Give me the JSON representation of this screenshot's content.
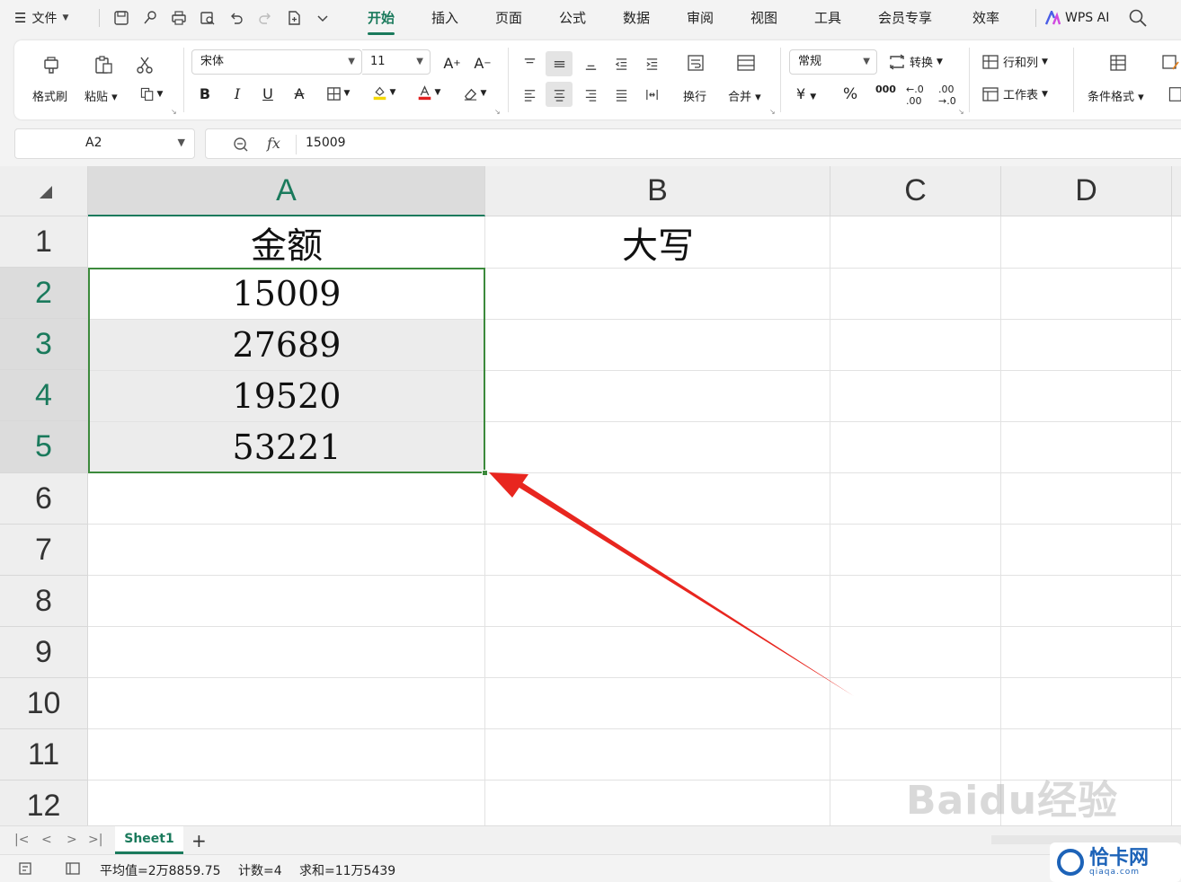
{
  "menubar": {
    "file_label": "文件",
    "tabs": [
      "开始",
      "插入",
      "页面",
      "公式",
      "数据",
      "审阅",
      "视图",
      "工具",
      "会员专享",
      "效率"
    ],
    "active_tab": "开始",
    "wps_ai_label": "WPS AI"
  },
  "ribbon": {
    "format_painter": "格式刷",
    "paste": "粘贴",
    "font_name": "宋体",
    "font_size": "11",
    "wrap": "换行",
    "merge": "合并",
    "number_format": "常规",
    "convert": "转换",
    "row_col": "行和列",
    "worksheet": "工作表",
    "cond_format": "条件格式",
    "bold": "B",
    "italic": "I",
    "underline": "U",
    "currency": "¥",
    "percent": "%"
  },
  "formula_bar": {
    "name_box": "A2",
    "fx": "fx",
    "content": "15009"
  },
  "grid": {
    "columns": [
      "A",
      "B",
      "C",
      "D"
    ],
    "rows": [
      "1",
      "2",
      "3",
      "4",
      "5",
      "6",
      "7",
      "8",
      "9",
      "10",
      "11",
      "12"
    ],
    "cells": {
      "A1": "金额",
      "B1": "大写",
      "A2": "15009",
      "A3": "27689",
      "A4": "19520",
      "A5": "53221"
    }
  },
  "watermark": "Baidu经验",
  "sheets": {
    "active": "Sheet1",
    "add": "+"
  },
  "status": {
    "average": "平均值=2万8859.75",
    "count": "计数=4",
    "sum": "求和=11万5439"
  },
  "logo": {
    "name": "恰卡网",
    "domain": "qiaqa.com"
  },
  "colors": {
    "accent": "#1a7a5c",
    "selection_border": "#3c8a3c",
    "arrow": "#e8261f"
  }
}
